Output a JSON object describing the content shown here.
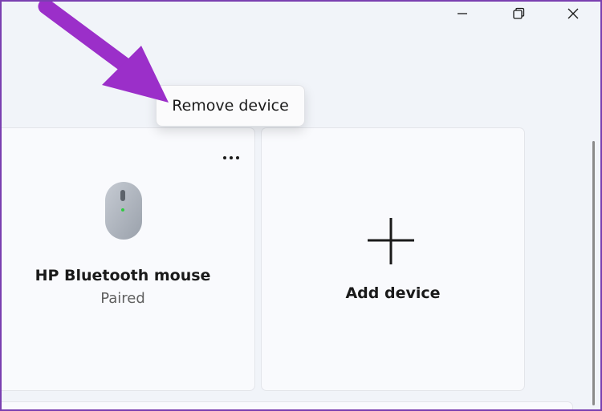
{
  "window": {
    "minimize_icon": "minimize-icon",
    "maximize_icon": "restore-icon",
    "close_icon": "close-icon"
  },
  "device_card": {
    "name": "HP Bluetooth mouse",
    "status": "Paired",
    "icon": "mouse-icon",
    "more_icon": "more-options-icon"
  },
  "add_card": {
    "label": "Add device",
    "icon": "plus-icon"
  },
  "context_menu": {
    "items": [
      {
        "label": "Remove device"
      }
    ]
  },
  "annotation": {
    "arrow_color": "#9b2fc9"
  },
  "colors": {
    "background": "#f1f4f9",
    "card": "#f9fafd",
    "frame": "#7a3fb0",
    "status_led": "#2ecc40"
  }
}
